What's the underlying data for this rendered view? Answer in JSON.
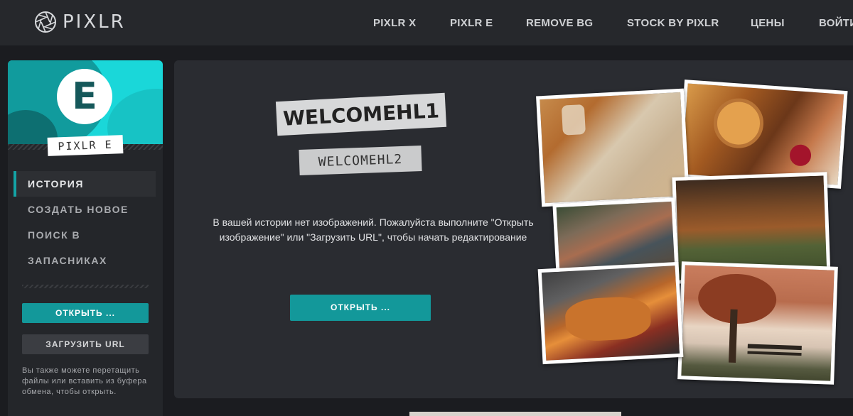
{
  "header": {
    "logo_text": "PIXLR",
    "nav": [
      "PIXLR X",
      "PIXLR E",
      "REMOVE BG",
      "STOCK BY PIXLR",
      "ЦЕНЫ",
      "ВОЙТИ"
    ]
  },
  "sidebar": {
    "app_letter": "E",
    "app_name": "PIXLR E",
    "menu": [
      "ИСТОРИЯ",
      "СОЗДАТЬ НОВОЕ",
      "ПОИСК В",
      "ЗАПАСНИКАХ"
    ],
    "open_button": "ОТКРЫТЬ ...",
    "url_button": "ЗАГРУЗИТЬ URL",
    "note": "Вы также можете перетащить файлы или вставить из буфера обмена, чтобы открыть."
  },
  "main": {
    "tag1": "WELCOMEHL1",
    "tag2": "WELCOMEHL2",
    "empty_message": "В вашей истории нет изображений. Пожалуйста выполните \"Открыть изображение\" или \"Загрузить URL\", чтобы начать редактирование",
    "open_button": "ОТКРЫТЬ ..."
  },
  "colors": {
    "accent": "#13989a",
    "brand_cyan": "#1ad7d9",
    "topbar_bg": "#26282c",
    "panel_bg": "#2a2c31"
  }
}
